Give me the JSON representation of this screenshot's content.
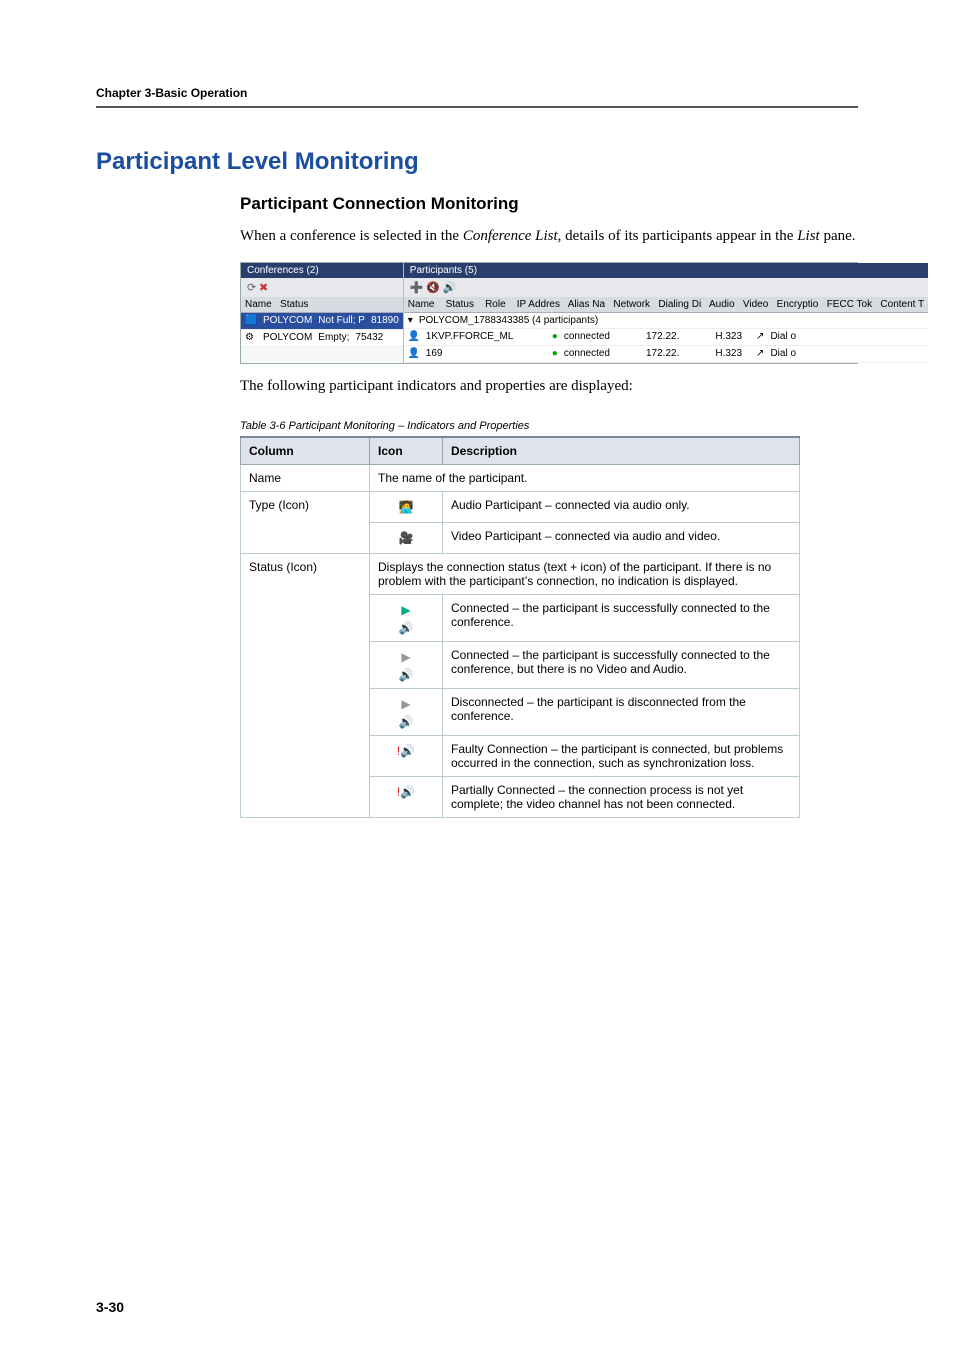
{
  "header": {
    "chapter": "Chapter 3-Basic Operation"
  },
  "headings": {
    "h1": "Participant Level Monitoring",
    "h2": "Participant Connection Monitoring"
  },
  "body": {
    "intro": {
      "part1": "When a conference is selected in the ",
      "ital1": "Conference List",
      "part2": ", details of its participants appear in the ",
      "ital2": "List",
      "part3": " pane."
    },
    "follow": "The following participant indicators and properties are displayed:"
  },
  "screenshot": {
    "left": {
      "title": "Conferences (2)",
      "headers": [
        "Name",
        "Status"
      ],
      "rows": [
        {
          "name": "POLYCOM",
          "status": "Not Full; P",
          "id": "81890"
        },
        {
          "name": "POLYCOM",
          "status": "Empty;",
          "id": "75432"
        }
      ]
    },
    "right": {
      "title": "Participants (5)",
      "headers": [
        "Name",
        "Status",
        "Role",
        "IP Addres",
        "Alias Na",
        "Network",
        "Dialing Di",
        "Audio",
        "Video",
        "Encryptio",
        "FECC Tok",
        "Content T"
      ],
      "group": "POLYCOM_1788343385 (4 participants)",
      "rows": [
        {
          "name": "1KVP.FFORCE_ML",
          "status": "connected",
          "ip": "172.22.",
          "network": "H.323",
          "dialing": "Dial o"
        },
        {
          "name": "169",
          "status": "connected",
          "ip": "172.22.",
          "network": "H.323",
          "dialing": "Dial o"
        }
      ]
    }
  },
  "table": {
    "caption": "Table 3-6 Participant Monitoring – Indicators and Properties",
    "headers": [
      "Column",
      "Icon",
      "Description"
    ],
    "rows": [
      {
        "col": "Name",
        "desc": "The name of the participant."
      },
      {
        "col": "Type (Icon)",
        "items": [
          {
            "icon": "audio-participant",
            "desc": "Audio Participant – connected via audio only."
          },
          {
            "icon": "video-participant",
            "desc": "Video Participant – connected via audio and video."
          }
        ]
      },
      {
        "col": "Status (Icon)",
        "intro": "Displays the connection status (text + icon) of the participant. If there is no problem with the participant’s connection, no indication is displayed.",
        "items": [
          {
            "icon": "connected",
            "desc": "Connected – the participant is successfully connected to the conference."
          },
          {
            "icon": "connected-nomedia",
            "desc": "Connected – the participant is successfully connected to the conference, but there is no Video and Audio."
          },
          {
            "icon": "partial-disconnected",
            "desc": "Disconnected – the participant is disconnected from the conference."
          },
          {
            "icon": "faulty",
            "desc": "Faulty Connection – the participant is connected, but problems occurred in the connection, such as synchronization loss."
          },
          {
            "icon": "partially-connected",
            "desc": "Partially Connected – the connection process is not yet complete; the video channel has not been connected."
          }
        ]
      }
    ]
  },
  "footer": {
    "page": "3-30"
  }
}
